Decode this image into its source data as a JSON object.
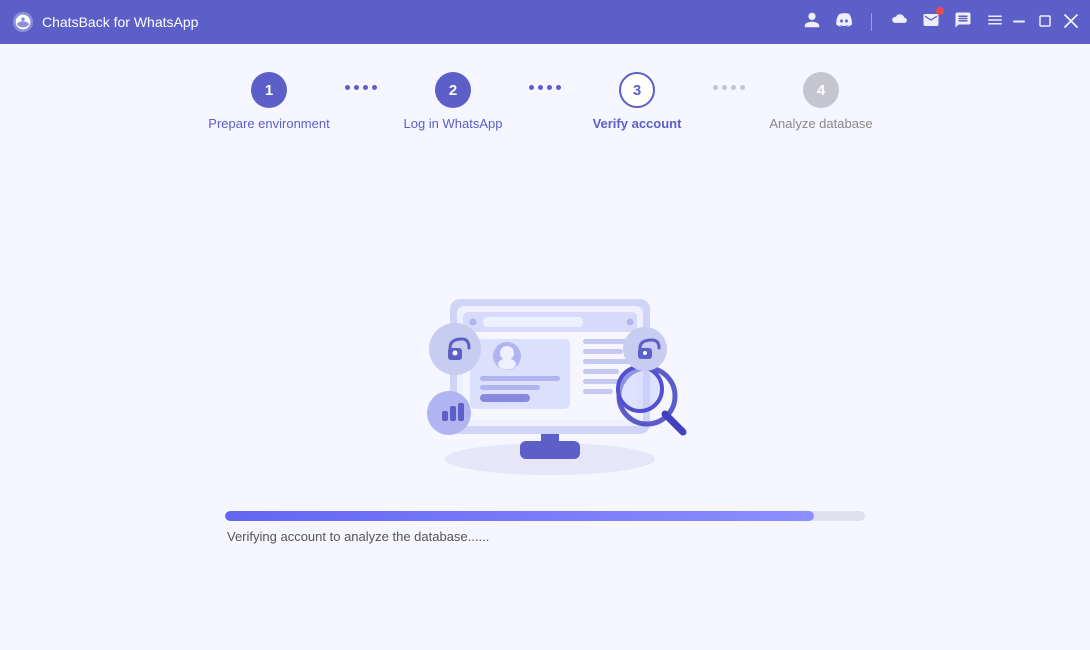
{
  "titlebar": {
    "logo_alt": "chatsback-logo",
    "title": "ChatsBack for WhatsApp",
    "icons": [
      "person-icon",
      "discord-icon",
      "cloud-icon",
      "mail-icon",
      "chat-icon",
      "menu-icon"
    ],
    "controls": [
      "minimize-icon",
      "maximize-icon",
      "close-icon"
    ]
  },
  "steps": [
    {
      "id": "prepare",
      "number": "1",
      "label": "Prepare environment",
      "state": "done"
    },
    {
      "id": "login",
      "number": "2",
      "label": "Log in WhatsApp",
      "state": "done"
    },
    {
      "id": "verify",
      "number": "3",
      "label": "Verify account",
      "state": "current"
    },
    {
      "id": "analyze",
      "number": "4",
      "label": "Analyze database",
      "state": "inactive"
    }
  ],
  "illustration": {
    "alt": "verify-account-illustration"
  },
  "progress": {
    "fill_percent": 92,
    "status_text": "Verifying account to analyze the database......"
  }
}
